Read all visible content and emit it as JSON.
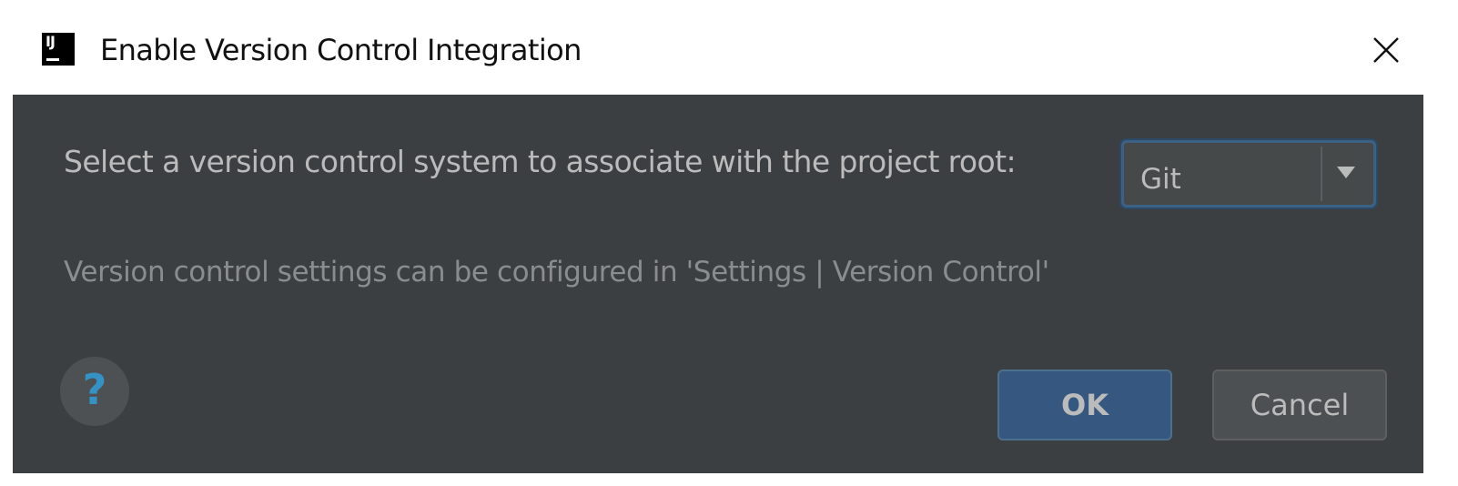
{
  "window": {
    "title": "Enable Version Control Integration",
    "app_icon": "intellij-idea-icon",
    "app_icon_text": "IJ",
    "close_icon": "close-icon"
  },
  "content": {
    "prompt_label": "Select a version control system to associate with the project root:",
    "vcs_select": {
      "selected_value": "Git",
      "arrow_icon": "dropdown-arrow-icon"
    },
    "hint_text": "Version control settings can be configured in 'Settings | Version Control'"
  },
  "footer": {
    "help_label": "?",
    "ok_label": "OK",
    "cancel_label": "Cancel"
  },
  "colors": {
    "panel_background": "#3c3f41",
    "label_text": "#bbbbbb",
    "hint_text": "#8a8d90",
    "focus_border": "#3d6185",
    "ok_button": "#365880",
    "cancel_button": "#4c5052",
    "help_icon": "#3592c4"
  }
}
